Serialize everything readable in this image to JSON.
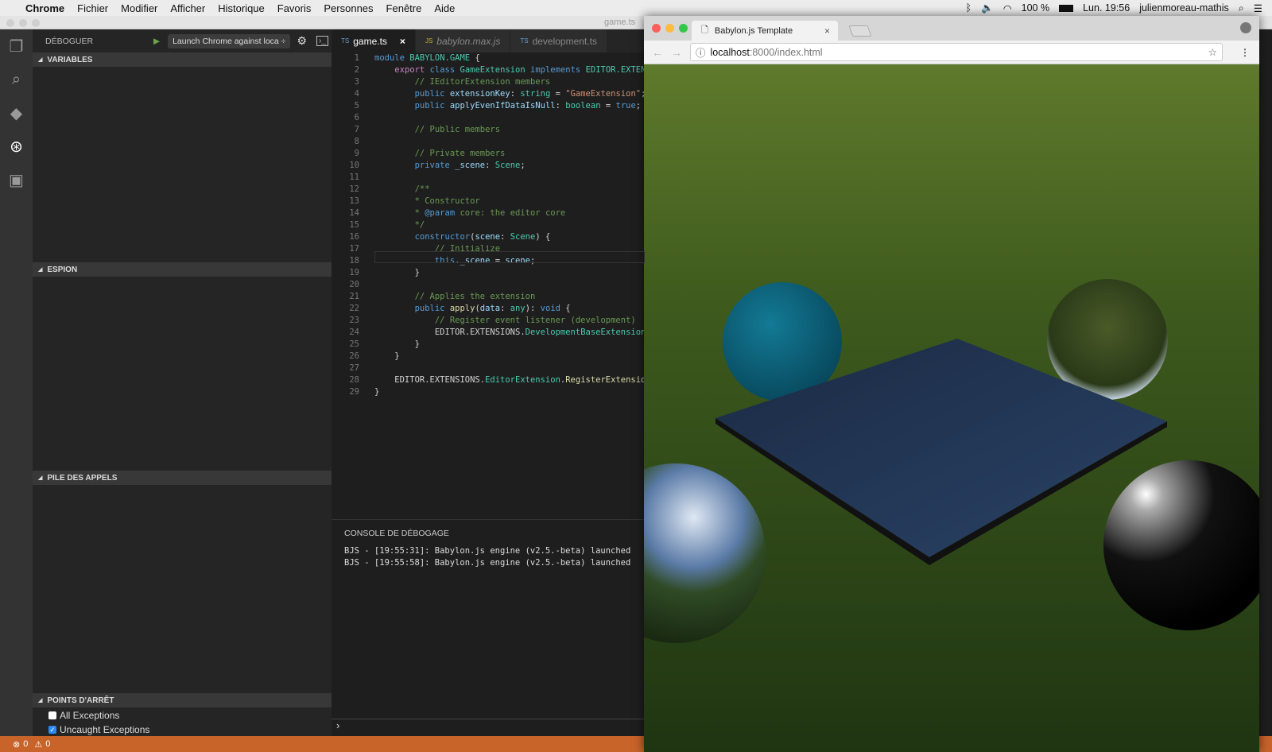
{
  "menubar": {
    "app": "Chrome",
    "items": [
      "Fichier",
      "Modifier",
      "Afficher",
      "Historique",
      "Favoris",
      "Personnes",
      "Fenêtre",
      "Aide"
    ],
    "battery": "100 %",
    "clock": "Lun. 19:56",
    "user": "julienmoreau-mathis"
  },
  "vscode": {
    "window_title": "game.ts",
    "activity": [
      {
        "name": "explorer-icon",
        "glyph": "❐"
      },
      {
        "name": "search-icon",
        "glyph": "⌕"
      },
      {
        "name": "git-icon",
        "glyph": "◆"
      },
      {
        "name": "debug-icon",
        "glyph": "⊛"
      },
      {
        "name": "extensions-icon",
        "glyph": "▣"
      }
    ],
    "debug": {
      "title": "DÉBOGUER",
      "config": "Launch Chrome against loca ÷",
      "sections": {
        "variables": "VARIABLES",
        "watch": "ESPION",
        "callstack": "PILE DES APPELS",
        "breakpoints": "POINTS D'ARRÊT"
      },
      "breakpoints": [
        {
          "label": "All Exceptions",
          "checked": false
        },
        {
          "label": "Uncaught Exceptions",
          "checked": true
        }
      ]
    },
    "tabs": [
      {
        "lang": "TS",
        "label": "game.ts",
        "active": true,
        "close": "×"
      },
      {
        "lang": "JS",
        "label": "babylon.max.js",
        "active": false
      },
      {
        "lang": "TS",
        "label": "development.ts",
        "active": false
      }
    ],
    "code": [
      [
        [
          "k1",
          "module "
        ],
        [
          "ty",
          "BABYLON.GAME"
        ],
        [
          "pl",
          " {"
        ]
      ],
      [
        [
          "pl",
          "    "
        ],
        [
          "k2",
          "export "
        ],
        [
          "k1",
          "class "
        ],
        [
          "ty",
          "GameExtension "
        ],
        [
          "k1",
          "implements "
        ],
        [
          "ty",
          "EDITOR.EXTENSIO"
        ]
      ],
      [
        [
          "cm",
          "        // IEditorExtension members"
        ]
      ],
      [
        [
          "pl",
          "        "
        ],
        [
          "k1",
          "public "
        ],
        [
          "pr",
          "extensionKey"
        ],
        [
          "pl",
          ": "
        ],
        [
          "ty",
          "string"
        ],
        [
          "pl",
          " = "
        ],
        [
          "st",
          "\"GameExtension\""
        ],
        [
          "pl",
          ";"
        ]
      ],
      [
        [
          "pl",
          "        "
        ],
        [
          "k1",
          "public "
        ],
        [
          "pr",
          "applyEvenIfDataIsNull"
        ],
        [
          "pl",
          ": "
        ],
        [
          "ty",
          "boolean"
        ],
        [
          "pl",
          " = "
        ],
        [
          "k1",
          "true"
        ],
        [
          "pl",
          ";"
        ]
      ],
      [],
      [
        [
          "cm",
          "        // Public members"
        ]
      ],
      [],
      [
        [
          "cm",
          "        // Private members"
        ]
      ],
      [
        [
          "pl",
          "        "
        ],
        [
          "k1",
          "private "
        ],
        [
          "pr",
          "_scene"
        ],
        [
          "pl",
          ": "
        ],
        [
          "ty",
          "Scene"
        ],
        [
          "pl",
          ";"
        ]
      ],
      [],
      [
        [
          "cm",
          "        /**"
        ]
      ],
      [
        [
          "cm",
          "        * Constructor"
        ]
      ],
      [
        [
          "cm",
          "        * "
        ],
        [
          "k1",
          "@param"
        ],
        [
          "cm",
          " core: the editor core"
        ]
      ],
      [
        [
          "cm",
          "        */"
        ]
      ],
      [
        [
          "pl",
          "        "
        ],
        [
          "k1",
          "constructor"
        ],
        [
          "pl",
          "("
        ],
        [
          "pr",
          "scene"
        ],
        [
          "pl",
          ": "
        ],
        [
          "ty",
          "Scene"
        ],
        [
          "pl",
          ") {"
        ]
      ],
      [
        [
          "cm",
          "            // Initialize"
        ]
      ],
      [
        [
          "pl",
          "            "
        ],
        [
          "k1",
          "this"
        ],
        [
          "pl",
          "."
        ],
        [
          "pr",
          "_scene"
        ],
        [
          "pl",
          " = "
        ],
        [
          "pr",
          "scene"
        ],
        [
          "pl",
          ";"
        ]
      ],
      [
        [
          "pl",
          "        }"
        ]
      ],
      [],
      [
        [
          "cm",
          "        // Applies the extension"
        ]
      ],
      [
        [
          "pl",
          "        "
        ],
        [
          "k1",
          "public "
        ],
        [
          "fn",
          "apply"
        ],
        [
          "pl",
          "("
        ],
        [
          "pr",
          "data"
        ],
        [
          "pl",
          ": "
        ],
        [
          "ty",
          "any"
        ],
        [
          "pl",
          "): "
        ],
        [
          "k1",
          "void"
        ],
        [
          "pl",
          " {"
        ]
      ],
      [
        [
          "cm",
          "            // Register event listener (development)"
        ]
      ],
      [
        [
          "pl",
          "            EDITOR.EXTENSIONS."
        ],
        [
          "ty",
          "DevelopmentBaseExtension"
        ],
        [
          "pl",
          "."
        ],
        [
          "fn",
          "Re"
        ]
      ],
      [
        [
          "pl",
          "        }"
        ]
      ],
      [
        [
          "pl",
          "    }"
        ]
      ],
      [],
      [
        [
          "pl",
          "    EDITOR.EXTENSIONS."
        ],
        [
          "ty",
          "EditorExtension"
        ],
        [
          "pl",
          "."
        ],
        [
          "fn",
          "RegisterExtension"
        ],
        [
          "pl",
          "("
        ]
      ],
      [
        [
          "pl",
          "}"
        ]
      ]
    ],
    "console": {
      "title": "CONSOLE DE DÉBOGAGE",
      "lines": [
        "BJS - [19:55:31]: Babylon.js engine (v2.5.-beta) launched",
        "BJS - [19:55:58]: Babylon.js engine (v2.5.-beta) launched"
      ],
      "prompt": "›"
    },
    "status": {
      "errors": "0",
      "warnings": "0"
    }
  },
  "chrome": {
    "tab_title": "Babylon.js Template",
    "tab_close": "×",
    "url_host": "localhost",
    "url_rest": ":8000/index.html"
  },
  "colors": {
    "status_bar": "#c8632a",
    "accent": "#2a8af6"
  }
}
